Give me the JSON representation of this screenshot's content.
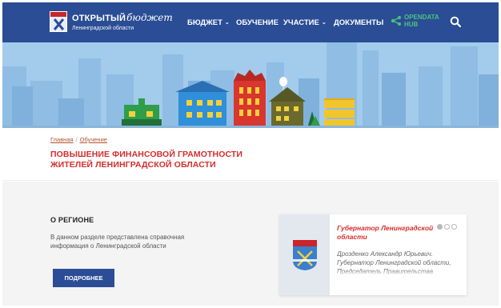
{
  "header": {
    "logo_title_a": "ОТКРЫТЫЙ",
    "logo_title_b": "бюджет",
    "logo_subtitle": "Ленинградской области",
    "nav": [
      {
        "label": "БЮДЖЕТ",
        "dropdown": true
      },
      {
        "label": "ОБУЧЕНИЕ",
        "dropdown": false
      },
      {
        "label": "УЧАСТИЕ",
        "dropdown": true
      },
      {
        "label": "ДОКУМЕНТЫ",
        "dropdown": false
      }
    ],
    "opendata_line1": "OPENDATA",
    "opendata_line2": "HUB",
    "chevron_glyph": "⌄",
    "colors": {
      "bar": "#2a4d95",
      "opendata": "#49c37c"
    }
  },
  "breadcrumb": {
    "home": "Главная",
    "separator": "/",
    "current": "Обучение"
  },
  "page_title_line1": "ПОВЫШЕНИЕ ФИНАНСОВОЙ ГРАМОТНОСТИ",
  "page_title_line2": "ЖИТЕЛЕЙ ЛЕНИНГРАДСКОЙ ОБЛАСТИ",
  "region": {
    "heading": "О РЕГИОНЕ",
    "text": "В данном разделе представлена справочная информация о Ленинградской области",
    "button": "ПОДРОБНЕЕ"
  },
  "governor_card": {
    "title": "Губернатор Ленинградской области",
    "description": "Дрозденко Александр Юрьевич. Губернатор Ленинградской области, Председатель Правительства",
    "slides_total": 3,
    "active_slide": 1
  },
  "colors": {
    "accent_red": "#d42d2b",
    "brand_blue": "#2a4d95"
  }
}
